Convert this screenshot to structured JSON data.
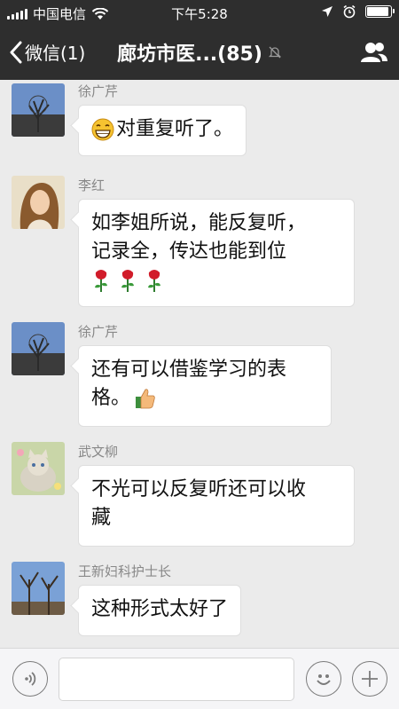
{
  "status_bar": {
    "carrier": "中国电信",
    "time": "下午5:28",
    "battery_level": 0.95
  },
  "nav": {
    "back_label": "微信(1)",
    "title": "廊坊市医...(85)"
  },
  "messages": [
    {
      "sender": "徐广芹",
      "text": "对重复听了。",
      "emoji": "grin-emoji"
    },
    {
      "sender": "李红",
      "text_lines": [
        "如李姐所说，能反复听，",
        "记录全，传达也能到位"
      ],
      "emoji": "rose-emoji-x3"
    },
    {
      "sender": "徐广芹",
      "text_lines": [
        "还有可以借鉴学习的表",
        "格。"
      ],
      "emoji": "thumbs-up-emoji"
    },
    {
      "sender": "武文柳",
      "text_lines": [
        "不光可以反复听还可以收",
        "藏"
      ]
    },
    {
      "sender": "王新妇科护士长",
      "text": "这种形式太好了"
    }
  ],
  "input": {
    "placeholder": ""
  }
}
